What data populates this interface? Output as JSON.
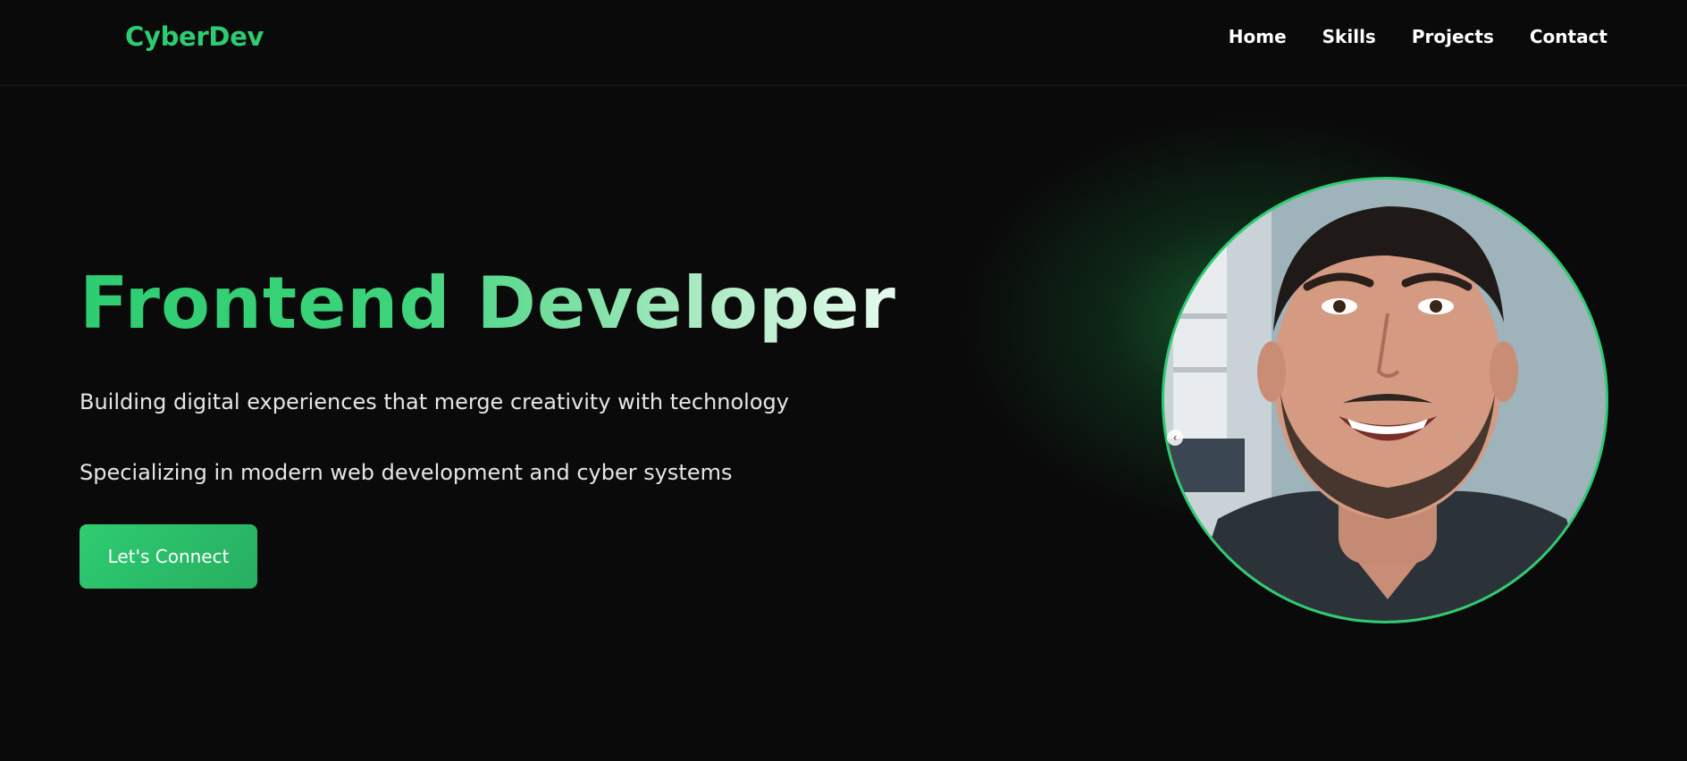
{
  "nav": {
    "logo": "CyberDev",
    "links": [
      "Home",
      "Skills",
      "Projects",
      "Contact"
    ]
  },
  "hero": {
    "title": "Frontend Developer",
    "subtitle1": "Building digital experiences that merge creativity with technology",
    "subtitle2": "Specializing in modern web development and cyber systems",
    "cta_label": "Let's Connect"
  },
  "colors": {
    "accent": "#2ecc71",
    "background": "#0a0a0a",
    "text": "#ffffff"
  },
  "icons": {
    "carousel_prev": "chevron-left-icon"
  }
}
